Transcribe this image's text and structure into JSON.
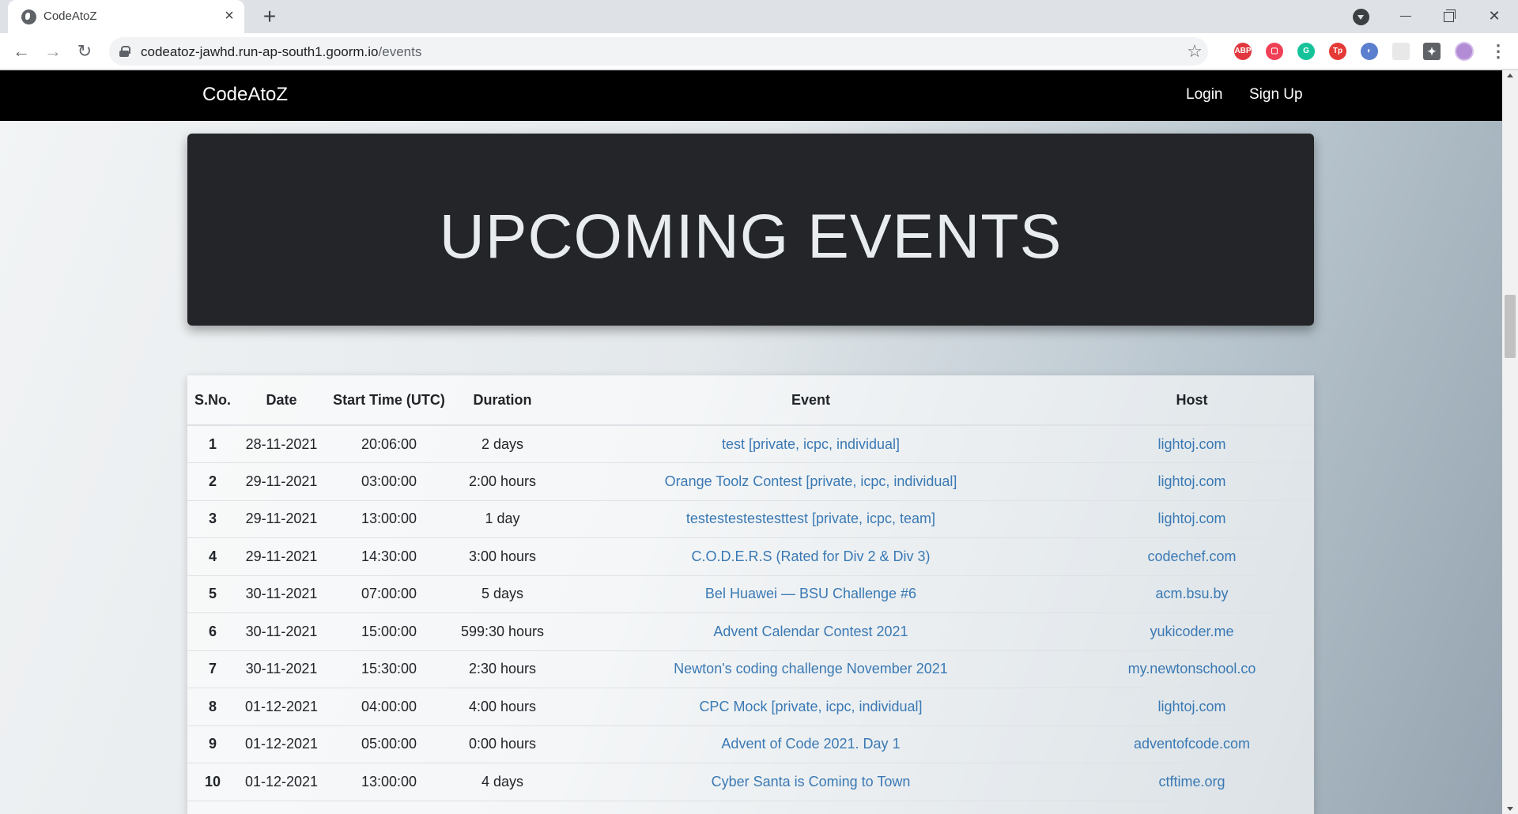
{
  "browser": {
    "tab_title": "CodeAtoZ",
    "url_host": "codeatoz-jawhd.run-ap-south1.goorm.io",
    "url_path": "/events",
    "extensions": [
      {
        "name": "adblock-plus-icon",
        "label": "ABP",
        "color": "#e0383e"
      },
      {
        "name": "pocket-icon",
        "label": "▢",
        "color": "#ef4056"
      },
      {
        "name": "grammarly-icon",
        "label": "G",
        "color": "#15c39a"
      },
      {
        "name": "tp-extension-icon",
        "label": "Tp",
        "color": "#e53935"
      },
      {
        "name": "blue-extension-icon",
        "label": "◐",
        "color": "#5b7fce"
      },
      {
        "name": "blank-extension-icon",
        "label": "",
        "color": "#e8e8e8"
      }
    ]
  },
  "site": {
    "brand": "CodeAtoZ",
    "nav": {
      "login": "Login",
      "signup": "Sign Up"
    }
  },
  "hero": {
    "title": "UPCOMING EVENTS"
  },
  "table": {
    "headers": {
      "sno": "S.No.",
      "date": "Date",
      "start": "Start Time (UTC)",
      "duration": "Duration",
      "event": "Event",
      "host": "Host"
    },
    "rows": [
      {
        "sno": "1",
        "date": "28-11-2021",
        "start": "20:06:00",
        "duration": "2 days",
        "event": "test [private, icpc, individual]",
        "host": "lightoj.com"
      },
      {
        "sno": "2",
        "date": "29-11-2021",
        "start": "03:00:00",
        "duration": "2:00 hours",
        "event": "Orange Toolz Contest [private, icpc, individual]",
        "host": "lightoj.com"
      },
      {
        "sno": "3",
        "date": "29-11-2021",
        "start": "13:00:00",
        "duration": "1 day",
        "event": "testestestestesttest [private, icpc, team]",
        "host": "lightoj.com"
      },
      {
        "sno": "4",
        "date": "29-11-2021",
        "start": "14:30:00",
        "duration": "3:00 hours",
        "event": "C.O.D.E.R.S (Rated for Div 2 & Div 3)",
        "host": "codechef.com"
      },
      {
        "sno": "5",
        "date": "30-11-2021",
        "start": "07:00:00",
        "duration": "5 days",
        "event": "Bel Huawei — BSU Challenge #6",
        "host": "acm.bsu.by"
      },
      {
        "sno": "6",
        "date": "30-11-2021",
        "start": "15:00:00",
        "duration": "599:30 hours",
        "event": "Advent Calendar Contest 2021",
        "host": "yukicoder.me"
      },
      {
        "sno": "7",
        "date": "30-11-2021",
        "start": "15:30:00",
        "duration": "2:30 hours",
        "event": "Newton's coding challenge November 2021",
        "host": "my.newtonschool.co"
      },
      {
        "sno": "8",
        "date": "01-12-2021",
        "start": "04:00:00",
        "duration": "4:00 hours",
        "event": "CPC Mock [private, icpc, individual]",
        "host": "lightoj.com"
      },
      {
        "sno": "9",
        "date": "01-12-2021",
        "start": "05:00:00",
        "duration": "0:00 hours",
        "event": "Advent of Code 2021. Day 1",
        "host": "adventofcode.com"
      },
      {
        "sno": "10",
        "date": "01-12-2021",
        "start": "13:00:00",
        "duration": "4 days",
        "event": "Cyber Santa is Coming to Town",
        "host": "ctftime.org"
      }
    ]
  }
}
